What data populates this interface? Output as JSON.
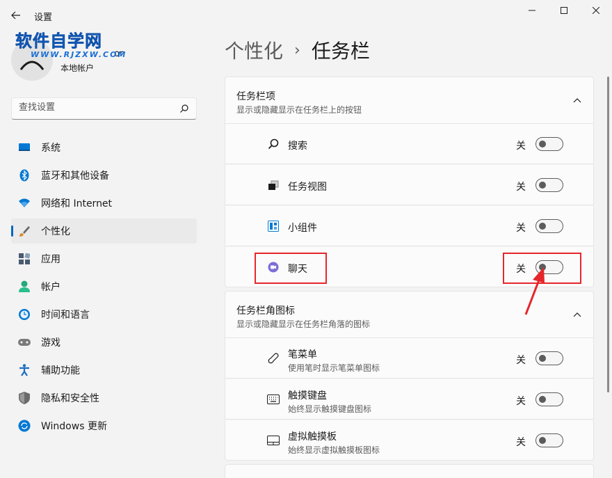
{
  "window": {
    "title": "设置"
  },
  "watermark": {
    "main": "软件自学网",
    "sub": "WWW.RJZXW.COM"
  },
  "profile": {
    "name_visible": "or",
    "account_type": "本地帐户"
  },
  "search": {
    "placeholder": "查找设置"
  },
  "nav": {
    "items": [
      {
        "label": "系统",
        "icon": "system-icon",
        "color": "#0078d4"
      },
      {
        "label": "蓝牙和其他设备",
        "icon": "bluetooth-icon",
        "color": "#0078d4"
      },
      {
        "label": "网络和 Internet",
        "icon": "network-icon",
        "color": "#0078d4"
      },
      {
        "label": "个性化",
        "icon": "personalization-icon",
        "color": "#d88c2e",
        "active": true
      },
      {
        "label": "应用",
        "icon": "apps-icon",
        "color": "#4a5b70"
      },
      {
        "label": "帐户",
        "icon": "account-icon",
        "color": "#23a97c"
      },
      {
        "label": "时间和语言",
        "icon": "time-language-icon",
        "color": "#0078d4"
      },
      {
        "label": "游戏",
        "icon": "gaming-icon",
        "color": "#7a7a7a"
      },
      {
        "label": "辅助功能",
        "icon": "accessibility-icon",
        "color": "#1b6ec2"
      },
      {
        "label": "隐私和安全性",
        "icon": "privacy-shield-icon",
        "color": "#6b6b6b"
      },
      {
        "label": "Windows 更新",
        "icon": "windows-update-icon",
        "color": "#0078d4"
      }
    ]
  },
  "breadcrumb": {
    "parent": "个性化",
    "separator": "›",
    "current": "任务栏"
  },
  "sections": {
    "taskbar_items": {
      "title": "任务栏项",
      "desc": "显示或隐藏显示在任务栏上的按钮",
      "rows": [
        {
          "label": "搜索",
          "icon": "search-icon",
          "state": "关",
          "on": false
        },
        {
          "label": "任务视图",
          "icon": "task-view-icon",
          "state": "关",
          "on": false
        },
        {
          "label": "小组件",
          "icon": "widgets-icon",
          "state": "关",
          "on": false
        },
        {
          "label": "聊天",
          "icon": "chat-icon",
          "state": "关",
          "on": false
        }
      ]
    },
    "corner_icons": {
      "title": "任务栏角图标",
      "desc": "显示或隐藏显示在任务栏角落的图标",
      "rows": [
        {
          "label": "笔菜单",
          "sub": "使用笔时显示笔菜单图标",
          "icon": "pen-icon",
          "state": "关",
          "on": false
        },
        {
          "label": "触摸键盘",
          "sub": "始终显示触摸键盘图标",
          "icon": "keyboard-icon",
          "state": "关",
          "on": false
        },
        {
          "label": "虚拟触摸板",
          "sub": "始终显示虚拟触摸板图标",
          "icon": "touchpad-icon",
          "state": "关",
          "on": false
        }
      ]
    }
  },
  "colors": {
    "accent": "#0067c0",
    "highlight": "#e5262b"
  }
}
